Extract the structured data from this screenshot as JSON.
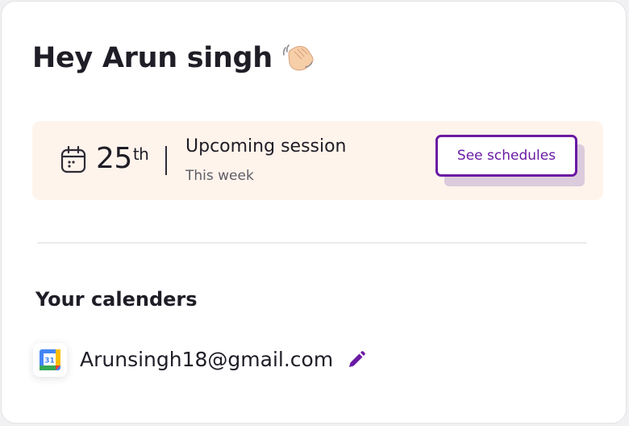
{
  "greeting": {
    "text": "Hey Arun singh",
    "emoji_icon": "waving-hand-icon"
  },
  "session": {
    "icon": "calendar-icon",
    "date_number": "25",
    "date_suffix": "th",
    "title": "Upcoming session",
    "subtitle": "This week",
    "button_label": "See schedules"
  },
  "calendars": {
    "heading": "Your calenders",
    "items": [
      {
        "provider_icon": "google-calendar-icon",
        "icon_text": "31",
        "email": "Arunsingh18@gmail.com",
        "action_icon": "edit-pencil-icon"
      }
    ]
  },
  "colors": {
    "accent": "#6a1aa3",
    "session_bg": "#fff4ec",
    "button_shadow": "#dccbdc",
    "text": "#1f1d26"
  }
}
